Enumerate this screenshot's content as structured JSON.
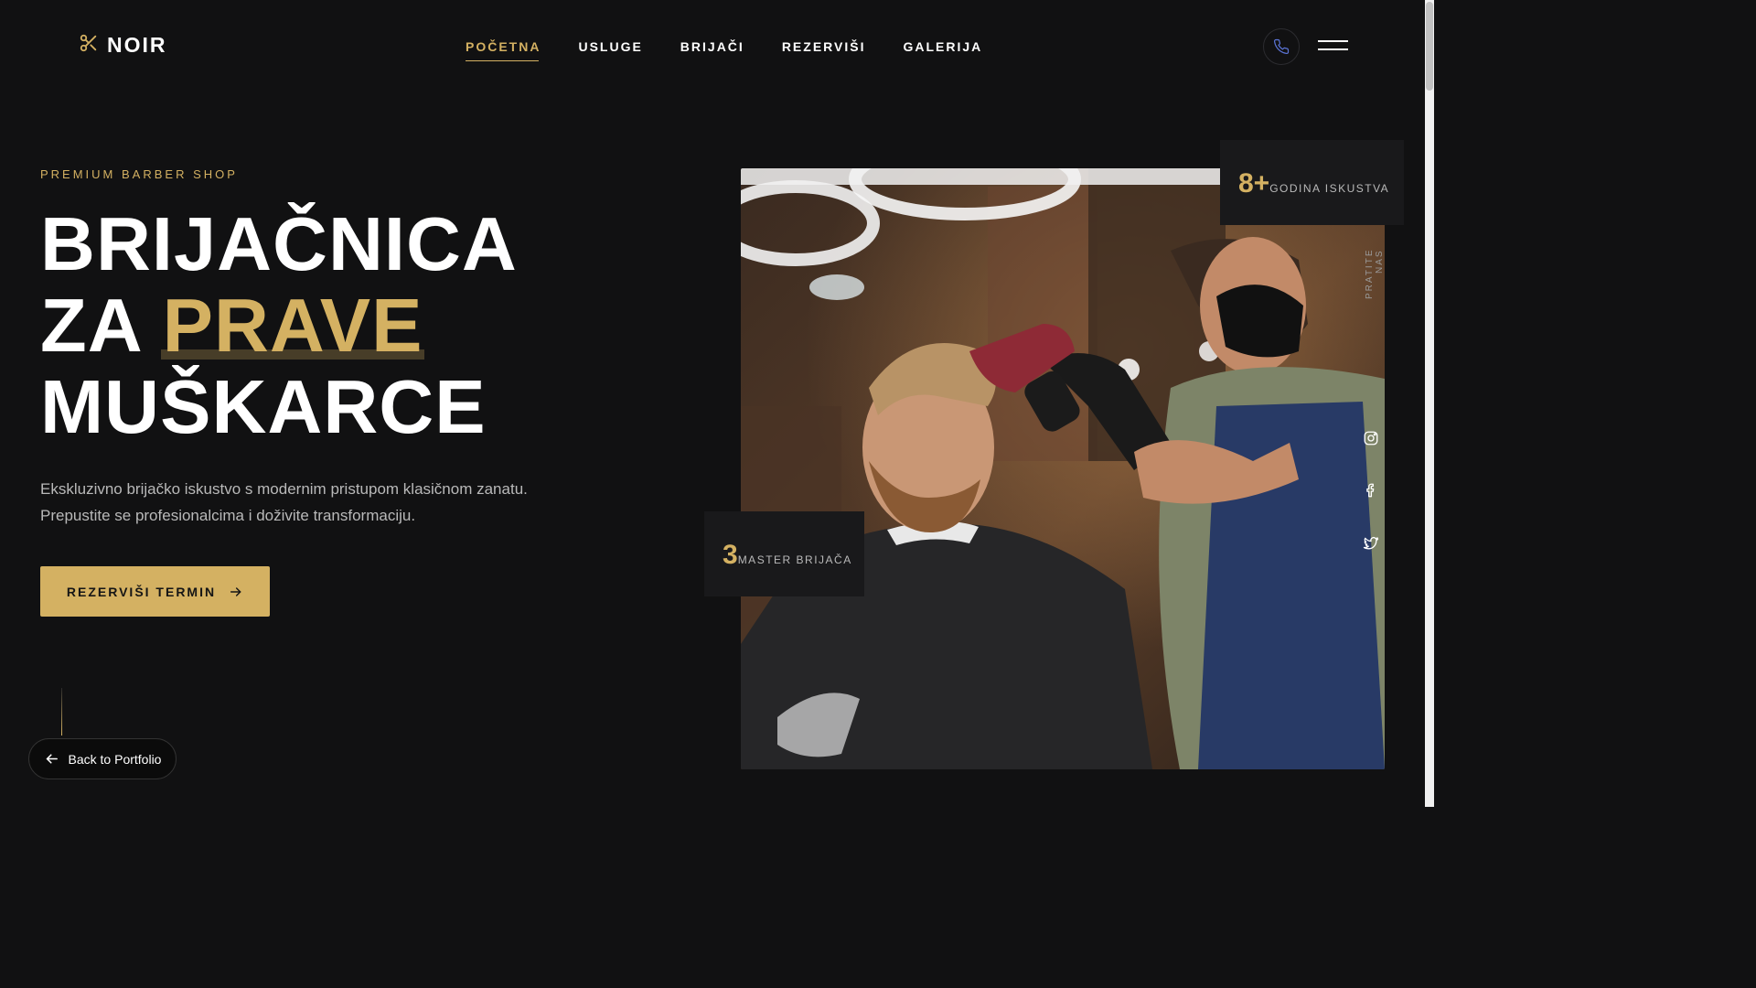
{
  "brand": {
    "name": "NOIR",
    "icon": "scissors-icon"
  },
  "nav": {
    "items": [
      {
        "label": "POČETNA",
        "active": true
      },
      {
        "label": "USLUGE"
      },
      {
        "label": "BRIJAČI"
      },
      {
        "label": "REZERVIŠI"
      },
      {
        "label": "GALERIJA"
      }
    ]
  },
  "header": {
    "phone_icon": "phone-icon",
    "menu_icon": "hamburger-menu-icon"
  },
  "hero": {
    "eyebrow": "PREMIUM BARBER SHOP",
    "headline_line1": "BRIJAČNICA",
    "headline_line2_prefix": "ZA",
    "headline_accent": "PRAVE",
    "headline_line3": "MUŠKARCE",
    "description_line1": "Ekskluzivno brijačko iskustvo s modernim pristupom klasičnom zanatu.",
    "description_line2": "Prepustite se profesionalcima i doživite transformaciju.",
    "cta_label": "REZERVIŠI TERMIN"
  },
  "stats": {
    "years": {
      "value": "8+",
      "label": "GODINA ISKUSTVA"
    },
    "masters": {
      "value": "3",
      "label": "MASTER BRIJAČA"
    }
  },
  "social": {
    "follow_label": "PRATITE NAS",
    "icons": [
      "instagram-icon",
      "facebook-icon",
      "twitter-icon"
    ]
  },
  "back": {
    "label": "Back to Portfolio"
  },
  "colors": {
    "accent": "#d4b162",
    "background": "#111112",
    "text": "#ffffff",
    "muted": "#b9b9b9"
  }
}
